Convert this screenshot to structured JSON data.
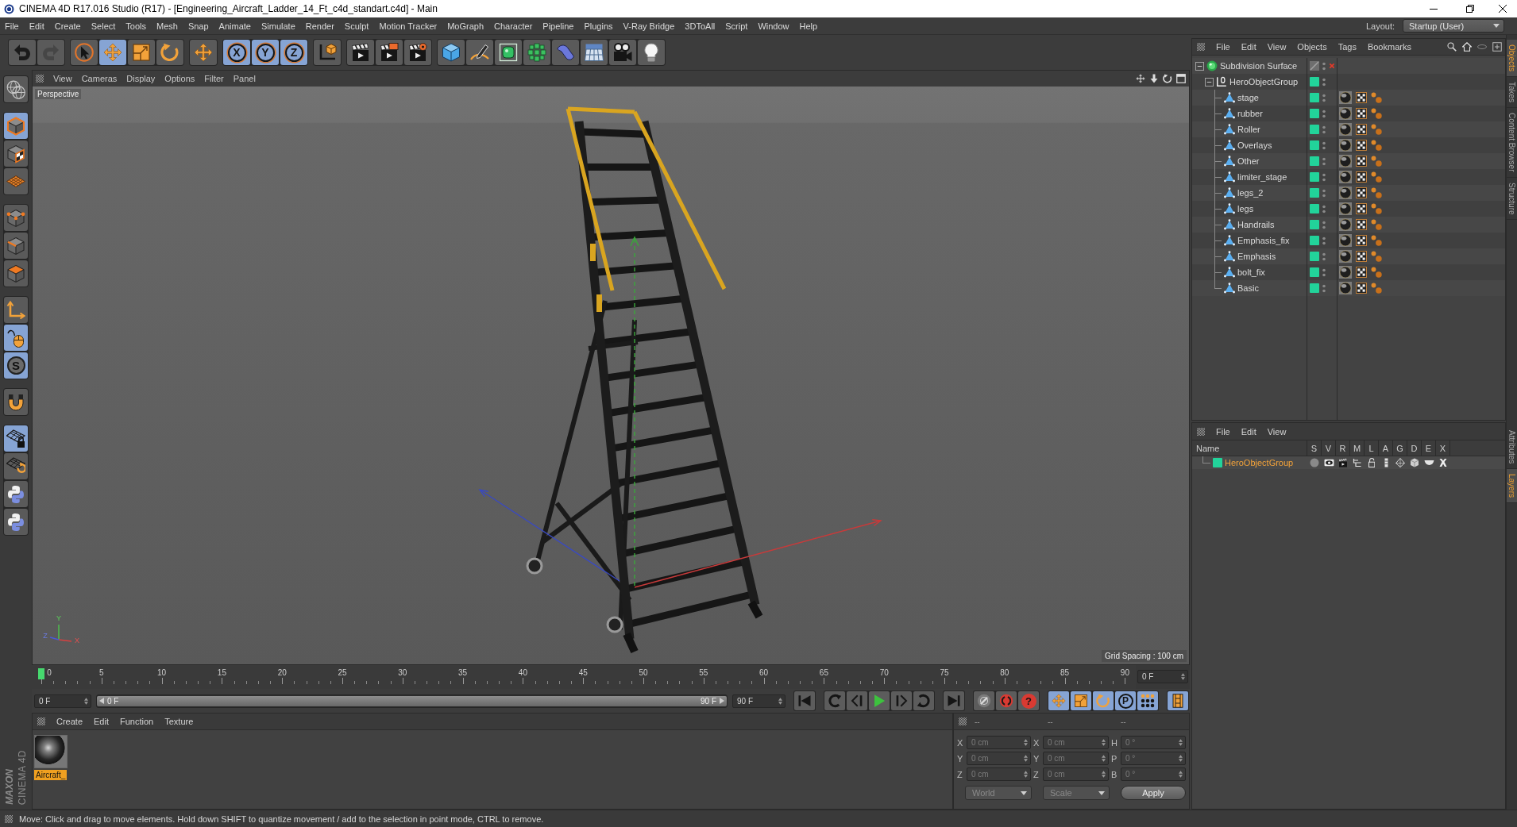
{
  "window": {
    "title": "CINEMA 4D R17.016 Studio (R17) - [Engineering_Aircraft_Ladder_14_Ft_c4d_standart.c4d] - Main"
  },
  "menu_bar": {
    "items": [
      "File",
      "Edit",
      "Create",
      "Select",
      "Tools",
      "Mesh",
      "Snap",
      "Animate",
      "Simulate",
      "Render",
      "Sculpt",
      "Motion Tracker",
      "MoGraph",
      "Character",
      "Pipeline",
      "Plugins",
      "V-Ray Bridge",
      "3DToAll",
      "Script",
      "Window",
      "Help"
    ],
    "layout_label": "Layout:",
    "layout_value": "Startup (User)"
  },
  "toolbar": {
    "buttons": [
      {
        "on": false,
        "disabled": false
      },
      {
        "on": false,
        "disabled": true
      },
      {
        "on": false,
        "disabled": false
      },
      {
        "on": true,
        "disabled": false
      },
      {
        "on": false,
        "disabled": false
      },
      {
        "on": false,
        "disabled": false
      },
      {
        "on": false,
        "disabled": false
      },
      {
        "label": "X",
        "on": true,
        "disabled": false
      },
      {
        "label": "Y",
        "on": true,
        "disabled": false
      },
      {
        "label": "Z",
        "on": true,
        "disabled": false
      },
      {
        "on": false,
        "disabled": false
      },
      {
        "on": false,
        "disabled": false
      },
      {
        "on": false,
        "disabled": false
      },
      {
        "on": false,
        "disabled": false
      },
      {
        "on": false,
        "disabled": false
      },
      {
        "on": false,
        "disabled": false
      },
      {
        "on": false,
        "disabled": false
      },
      {
        "on": false,
        "disabled": false
      },
      {
        "on": false,
        "disabled": false
      },
      {
        "on": false,
        "disabled": false
      },
      {
        "on": false,
        "disabled": false
      },
      {
        "on": false,
        "disabled": false
      }
    ]
  },
  "mode_bar": {
    "buttons": [
      {
        "on": false
      },
      {
        "on": true
      },
      {
        "on": false
      },
      {
        "on": false
      },
      {
        "on": false
      },
      {
        "on": false
      },
      {
        "on": false
      },
      {
        "on": false
      },
      {
        "on": true
      },
      {
        "label": "S",
        "on": true
      },
      {
        "on": false
      },
      {
        "on": true
      },
      {
        "on": false
      },
      {
        "on": false
      },
      {
        "on": false
      }
    ]
  },
  "viewport": {
    "menu": [
      "View",
      "Cameras",
      "Display",
      "Options",
      "Filter",
      "Panel"
    ],
    "camera": "Perspective",
    "grid_spacing": "Grid Spacing : 100 cm",
    "gizmo": {
      "y": "Y",
      "z": "Z",
      "x": "X"
    }
  },
  "object_manager": {
    "menu": [
      "File",
      "Edit",
      "View",
      "Objects",
      "Tags",
      "Bookmarks"
    ],
    "objects": [
      {
        "name": "Subdivision Surface",
        "kind": "generator",
        "expanded": true,
        "enabled": false,
        "children": [
          {
            "name": "HeroObjectGroup",
            "kind": "group",
            "expanded": true,
            "children": [
              {
                "name": "stage",
                "kind": "polygon"
              },
              {
                "name": "rubber",
                "kind": "polygon"
              },
              {
                "name": "Roller",
                "kind": "polygon"
              },
              {
                "name": "Overlays",
                "kind": "polygon"
              },
              {
                "name": "Other",
                "kind": "polygon"
              },
              {
                "name": "limiter_stage",
                "kind": "polygon"
              },
              {
                "name": "legs_2",
                "kind": "polygon"
              },
              {
                "name": "legs",
                "kind": "polygon"
              },
              {
                "name": "Handrails",
                "kind": "polygon"
              },
              {
                "name": "Emphasis_fix",
                "kind": "polygon"
              },
              {
                "name": "Emphasis",
                "kind": "polygon"
              },
              {
                "name": "bolt_fix",
                "kind": "polygon"
              },
              {
                "name": "Basic",
                "kind": "polygon"
              }
            ]
          }
        ]
      }
    ]
  },
  "layer_manager": {
    "menu": [
      "File",
      "Edit",
      "View"
    ],
    "columns": [
      "Name",
      "S",
      "V",
      "R",
      "M",
      "L",
      "A",
      "G",
      "D",
      "E",
      "X"
    ],
    "layers": [
      {
        "name": "HeroObjectGroup",
        "selected": true
      }
    ]
  },
  "side_tabs": {
    "upper": [
      {
        "label": "Objects",
        "selected": true
      },
      {
        "label": "Takes",
        "selected": false
      },
      {
        "label": "Content Browser",
        "selected": false
      },
      {
        "label": "Structure",
        "selected": false
      }
    ],
    "lower": [
      {
        "label": "Attributes",
        "selected": false
      },
      {
        "label": "Layers",
        "selected": true
      }
    ]
  },
  "timeline": {
    "frame_labels": [
      "0",
      "5",
      "10",
      "15",
      "20",
      "25",
      "30",
      "35",
      "40",
      "45",
      "50",
      "55",
      "60",
      "65",
      "70",
      "75",
      "80",
      "85",
      "90"
    ],
    "playhead": {
      "level": 0
    },
    "current_frame": "0 F"
  },
  "transport": {
    "start": "0 F",
    "range_start": "0 F",
    "range_end": "90 F",
    "range": {
      "level": 1
    },
    "end": "90 F",
    "buttons": [
      {
        "on": false
      },
      {
        "on": false
      },
      {
        "on": false
      },
      {
        "on": false
      },
      {
        "on": false
      },
      {
        "on": false
      },
      {
        "on": false
      },
      {
        "on": false
      },
      {
        "on": false
      },
      {
        "label": "?",
        "on": false
      },
      {
        "on": true
      },
      {
        "on": true
      },
      {
        "on": true
      },
      {
        "label": "P",
        "on": true
      },
      {
        "on": true
      },
      {
        "on": true
      }
    ]
  },
  "material_manager": {
    "menu": [
      "Create",
      "Edit",
      "Function",
      "Texture"
    ],
    "materials": [
      {
        "name": "Aircraft_",
        "selected": true
      }
    ]
  },
  "coordinates": {
    "disabled": true,
    "headers": [
      "--",
      "--",
      "--"
    ],
    "position": [
      {
        "axis": "X",
        "value": "0 cm"
      },
      {
        "axis": "Y",
        "value": "0 cm"
      },
      {
        "axis": "Z",
        "value": "0 cm"
      }
    ],
    "size": [
      {
        "axis": "X",
        "value": "0 cm"
      },
      {
        "axis": "Y",
        "value": "0 cm"
      },
      {
        "axis": "Z",
        "value": "0 cm"
      }
    ],
    "rotation": [
      {
        "axis": "H",
        "value": "0 °"
      },
      {
        "axis": "P",
        "value": "0 °"
      },
      {
        "axis": "B",
        "value": "0 °"
      }
    ],
    "space": "World",
    "size_mode": "Scale",
    "apply": "Apply"
  },
  "brand": {
    "maker": "MAXON",
    "product": "CINEMA 4D"
  },
  "status_bar": {
    "text": "Move: Click and drag to move elements. Hold down SHIFT to quantize movement / add to the selection in point mode, CTRL to remove."
  }
}
